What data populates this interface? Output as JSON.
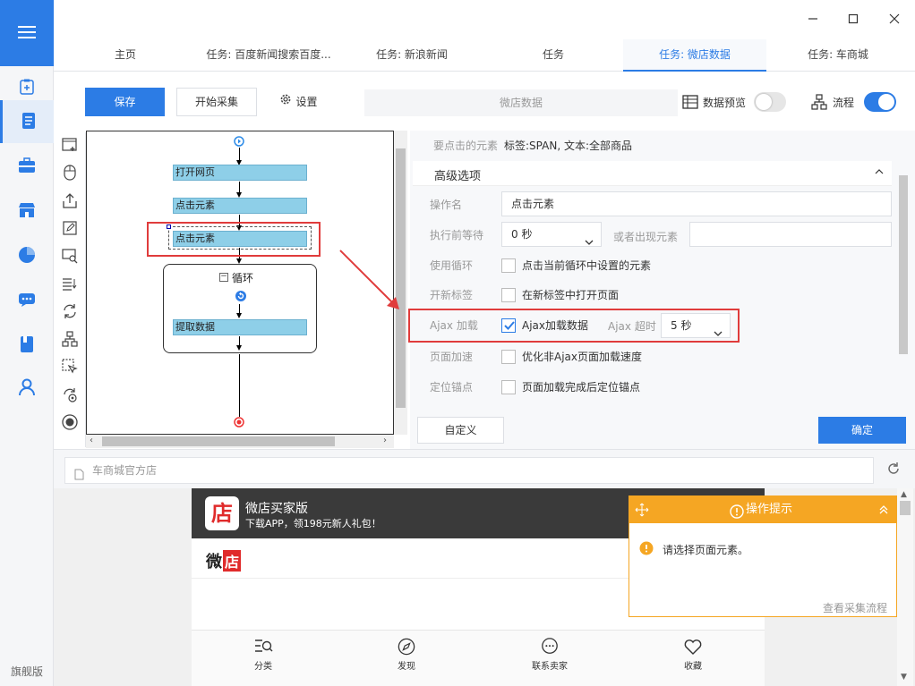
{
  "sidebar": {
    "edition": "旗舰版"
  },
  "tabs": [
    {
      "label": "主页"
    },
    {
      "label": "任务: 百度新闻搜索百度..."
    },
    {
      "label": "任务: 新浪新闻"
    },
    {
      "label": "任务"
    },
    {
      "label": "任务: 微店数据"
    },
    {
      "label": "任务: 车商城"
    }
  ],
  "toolbar": {
    "save_label": "保存",
    "start_label": "开始采集",
    "settings_label": "设置",
    "task_title": "微店数据",
    "preview_label": "数据预览",
    "flow_label": "流程"
  },
  "workflow": {
    "node_open": "打开网页",
    "node_click1": "点击元素",
    "node_click2": "点击元素",
    "loop_label": "循环",
    "node_extract": "提取数据"
  },
  "props": {
    "target_label": "要点击的元素",
    "target_value": "标签:SPAN, 文本:全部商品",
    "advanced_label": "高级选项",
    "op_name_label": "操作名",
    "op_name_value": "点击元素",
    "wait_label": "执行前等待",
    "wait_value": "0 秒",
    "or_appear_label": "或者出现元素",
    "loop_label": "使用循环",
    "loop_check_label": "点击当前循环中设置的元素",
    "newtab_label": "开新标签",
    "newtab_check_label": "在新标签中打开页面",
    "ajax_label": "Ajax 加载",
    "ajax_check_label": "Ajax加载数据",
    "ajax_timeout_label": "Ajax 超时",
    "ajax_timeout_value": "5 秒",
    "speed_label": "页面加速",
    "speed_check_label": "优化非Ajax页面加载速度",
    "anchor_label": "定位锚点",
    "anchor_check_label": "页面加载完成后定位锚点",
    "custom_label": "自定义",
    "ok_label": "确定"
  },
  "browser": {
    "address": "车商城官方店",
    "app_name": "微店买家版",
    "app_promo": "下载APP，领198元新人礼包！",
    "logo_text": "店",
    "brand_text_a": "微",
    "brand_text_b": "店",
    "footer": [
      {
        "label": "分类"
      },
      {
        "label": "发现"
      },
      {
        "label": "联系卖家"
      },
      {
        "label": "收藏"
      }
    ]
  },
  "tip": {
    "title": "操作提示",
    "message": "请选择页面元素。",
    "link": "查看采集流程"
  },
  "colors": {
    "accent": "#2c7ce5",
    "warning": "#f5a623",
    "annotation": "#e03c3c"
  }
}
